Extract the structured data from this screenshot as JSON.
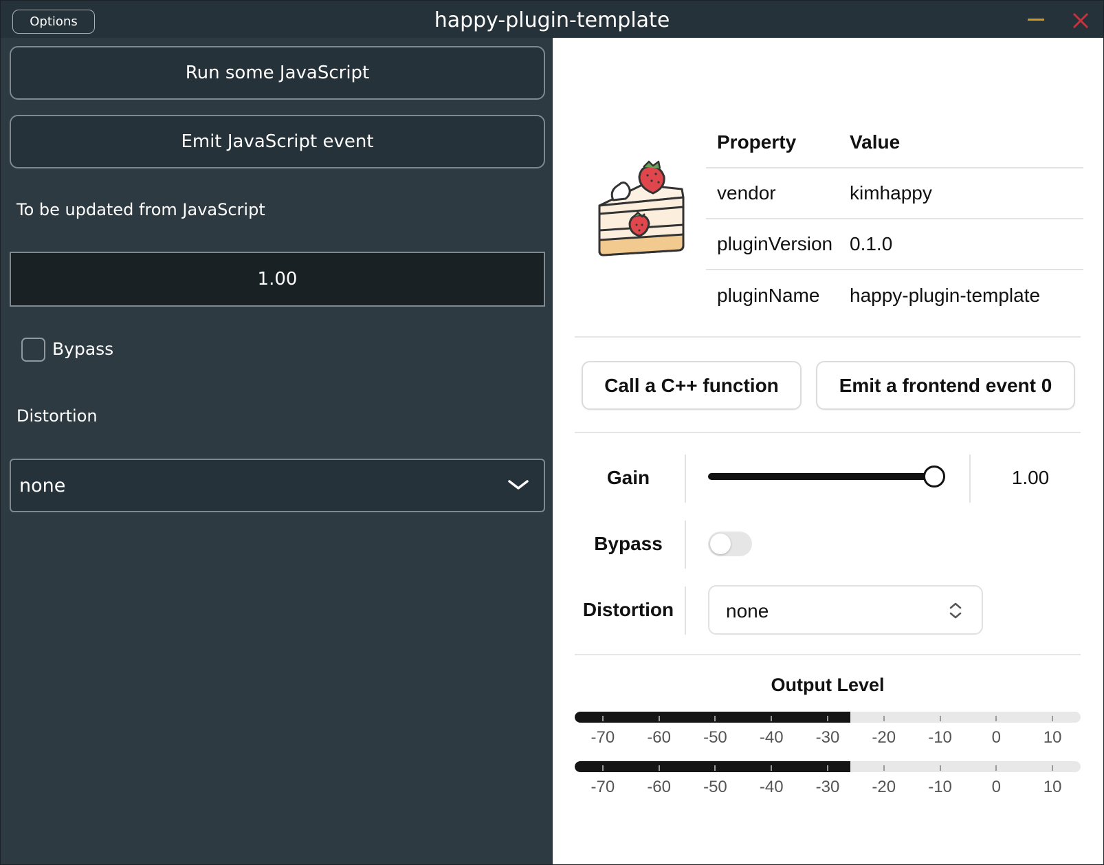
{
  "window": {
    "title": "happy-plugin-template",
    "options_label": "Options",
    "minimize_color": "#d29a1c",
    "close_color": "#c8323c"
  },
  "native": {
    "run_js_label": "Run some JavaScript",
    "emit_js_event_label": "Emit JavaScript event",
    "updated_label": "To be updated from JavaScript",
    "updated_value": "1.00",
    "bypass_label": "Bypass",
    "bypass_checked": false,
    "distortion_label": "Distortion",
    "distortion_value": "none"
  },
  "web": {
    "logo_icon": "strawberry-cake-icon",
    "table": {
      "headers": [
        "Property",
        "Value"
      ],
      "rows": [
        [
          "vendor",
          "kimhappy"
        ],
        [
          "pluginVersion",
          "0.1.0"
        ],
        [
          "pluginName",
          "happy-plugin-template"
        ]
      ]
    },
    "call_cpp_label": "Call a C++ function",
    "emit_frontend_label": "Emit a frontend event 0",
    "gain_label": "Gain",
    "gain_value": "1.00",
    "gain_fraction": 1.0,
    "bypass_label": "Bypass",
    "bypass_on": false,
    "distortion_label": "Distortion",
    "distortion_value": "none",
    "output_level_title": "Output Level",
    "meter_scale": [
      "-70",
      "-60",
      "-50",
      "-40",
      "-30",
      "-20",
      "-10",
      "0",
      "10"
    ],
    "meter_range_db": [
      -75,
      15
    ],
    "meters": [
      {
        "level_db": -26
      },
      {
        "level_db": -26
      }
    ]
  }
}
